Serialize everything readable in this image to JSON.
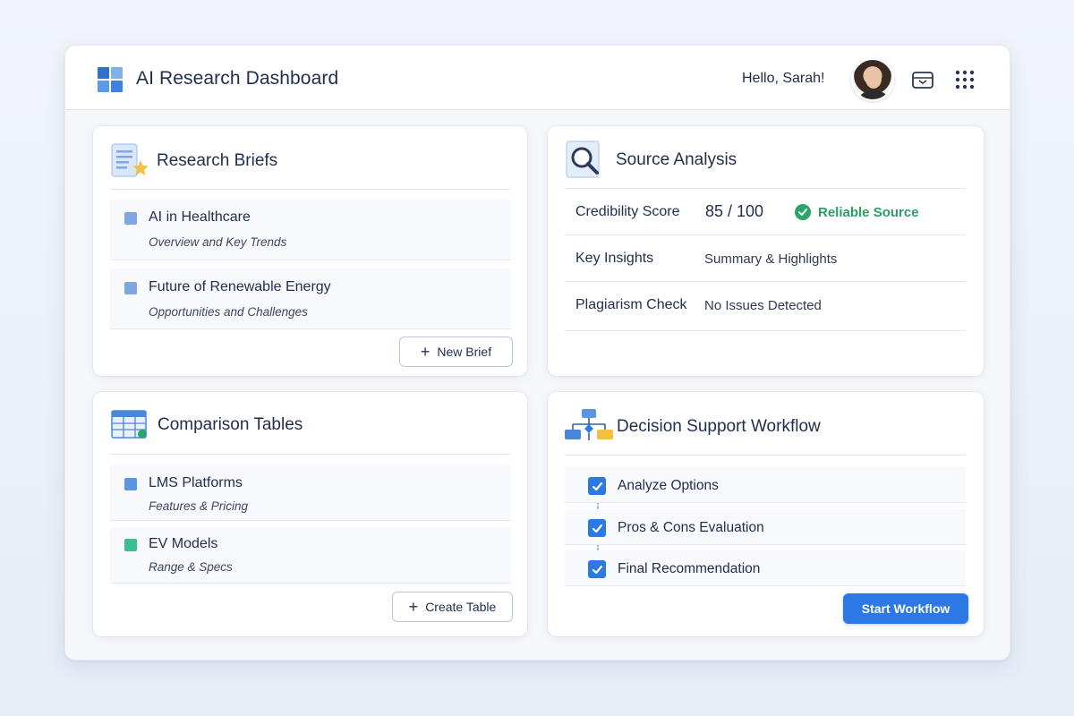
{
  "header": {
    "app_title": "AI Research Dashboard",
    "greeting": "Hello, Sarah!",
    "icons": [
      "logo-grid-icon",
      "avatar",
      "inbox-icon",
      "apps-grid-icon"
    ]
  },
  "research_briefs": {
    "title": "Research Briefs",
    "items": [
      {
        "title": "AI in Healthcare",
        "subtitle": "Overview and Key Trends"
      },
      {
        "title": "Future of Renewable Energy",
        "subtitle": "Opportunities and Challenges"
      }
    ],
    "button_label": "New Brief"
  },
  "source_analysis": {
    "title": "Source Analysis",
    "credibility_label": "Credibility Score",
    "credibility_value": "85 / 100",
    "credibility_badge": "Reliable Source",
    "key_insights_label": "Key Insights",
    "key_insights_value": "Summary & Highlights",
    "plagiarism_label": "Plagiarism Check",
    "plagiarism_value": "No Issues Detected"
  },
  "comparison_tables": {
    "title": "Comparison Tables",
    "items": [
      {
        "title": "LMS Platforms",
        "subtitle": "Features & Pricing"
      },
      {
        "title": "EV Models",
        "subtitle": "Range & Specs"
      }
    ],
    "button_label": "Create Table"
  },
  "decision_workflow": {
    "title": "Decision Support Workflow",
    "steps": [
      {
        "label": "Analyze Options",
        "checked": true
      },
      {
        "label": "Pros & Cons Evaluation",
        "checked": true
      },
      {
        "label": "Final Recommendation",
        "checked": true
      }
    ],
    "button_label": "Start Workflow"
  },
  "colors": {
    "accent": "#2c78e4",
    "success": "#2aa36c",
    "text": "#1f2e4d"
  }
}
